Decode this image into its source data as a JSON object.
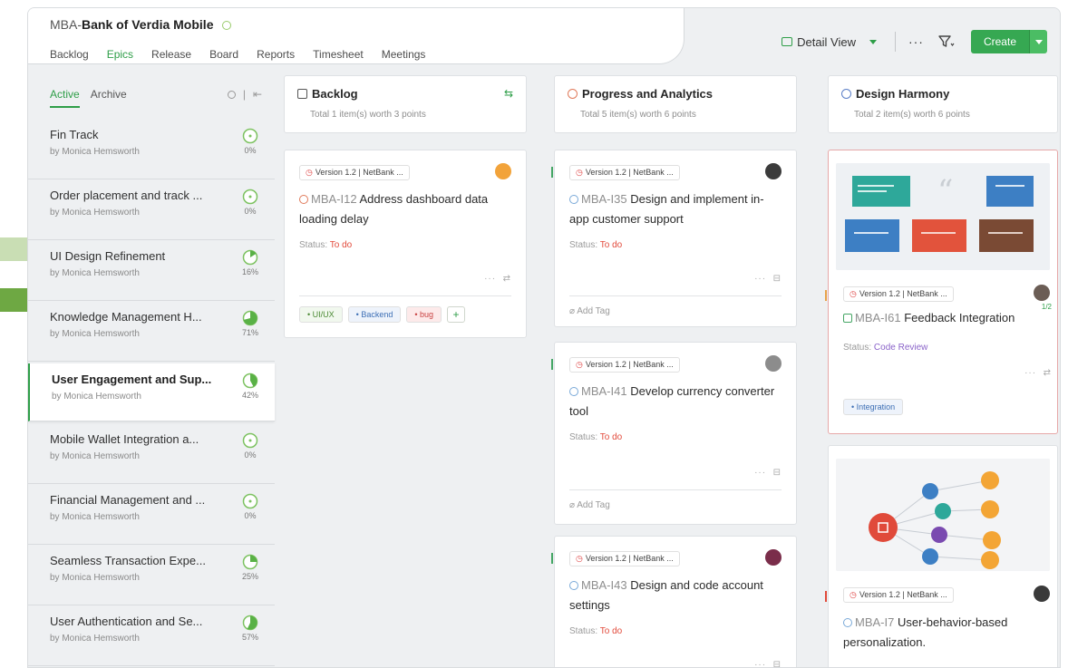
{
  "header": {
    "project_prefix": "MBA-",
    "project_name": "Bank of Verdia Mobile",
    "nav": [
      "Backlog",
      "Epics",
      "Release",
      "Board",
      "Reports",
      "Timesheet",
      "Meetings"
    ],
    "active_nav": "Epics",
    "detail_view_label": "Detail View",
    "more_label": "···",
    "create_label": "Create"
  },
  "sidebar": {
    "tab_active": "Active",
    "tab_archive": "Archive",
    "epics": [
      {
        "title": "Fin Track",
        "by": "by Monica Hemsworth",
        "pct": "0%",
        "progress": 0
      },
      {
        "title": "Order placement and track ...",
        "by": "by Monica Hemsworth",
        "pct": "0%",
        "progress": 0
      },
      {
        "title": "UI Design Refinement",
        "by": "by Monica Hemsworth",
        "pct": "16%",
        "progress": 16
      },
      {
        "title": "Knowledge Management H...",
        "by": "by Monica Hemsworth",
        "pct": "71%",
        "progress": 71
      },
      {
        "title": "User Engagement and Sup...",
        "by": "by Monica Hemsworth",
        "pct": "42%",
        "progress": 42
      },
      {
        "title": "Mobile Wallet Integration a...",
        "by": "by Monica Hemsworth",
        "pct": "0%",
        "progress": 0
      },
      {
        "title": "Financial Management and ...",
        "by": "by Monica Hemsworth",
        "pct": "0%",
        "progress": 0
      },
      {
        "title": "Seamless Transaction Expe...",
        "by": "by Monica Hemsworth",
        "pct": "25%",
        "progress": 25
      },
      {
        "title": "User Authentication and Se...",
        "by": "by Monica Hemsworth",
        "pct": "57%",
        "progress": 57
      }
    ],
    "selected_index": 4
  },
  "columns": [
    {
      "name": "Backlog",
      "summary": "Total 1 item(s) worth 3 points",
      "cards": [
        {
          "release": "Version 1.2 | NetBank ...",
          "id": "MBA-I12",
          "title": "Address dashboard data loading delay",
          "status_label": "Status:",
          "status": "To do",
          "tags": [
            "UI/UX",
            "Backend",
            "bug"
          ]
        }
      ]
    },
    {
      "name": "Progress and Analytics",
      "summary": "Total 5 item(s) worth 6 points",
      "cards": [
        {
          "release": "Version 1.2 | NetBank ...",
          "id": "MBA-I35",
          "title": "Design and implement in-app customer support",
          "status_label": "Status:",
          "status": "To do",
          "add_tag": "Add Tag"
        },
        {
          "release": "Version 1.2 | NetBank ...",
          "id": "MBA-I41",
          "title": "Develop currency converter tool",
          "status_label": "Status:",
          "status": "To do",
          "add_tag": "Add Tag"
        },
        {
          "release": "Version 1.2 | NetBank ...",
          "id": "MBA-I43",
          "title": "Design and code account settings",
          "status_label": "Status:",
          "status": "To do"
        }
      ]
    },
    {
      "name": "Design Harmony",
      "summary": "Total 2 item(s) worth 6 points",
      "cards": [
        {
          "release": "Version 1.2 | NetBank ...",
          "id": "MBA-I61",
          "title": "Feedback Integration",
          "status_label": "Status:",
          "status": "Code Review",
          "tags": [
            "Integration"
          ],
          "badge": "1/2"
        },
        {
          "release": "Version 1.2 | NetBank ...",
          "id": "MBA-I7",
          "title": "User-behavior-based personalization."
        }
      ]
    }
  ],
  "colors": {
    "accent": "#2e9e48",
    "status_todo": "#e24a3b",
    "status_review": "#8a63c9"
  }
}
